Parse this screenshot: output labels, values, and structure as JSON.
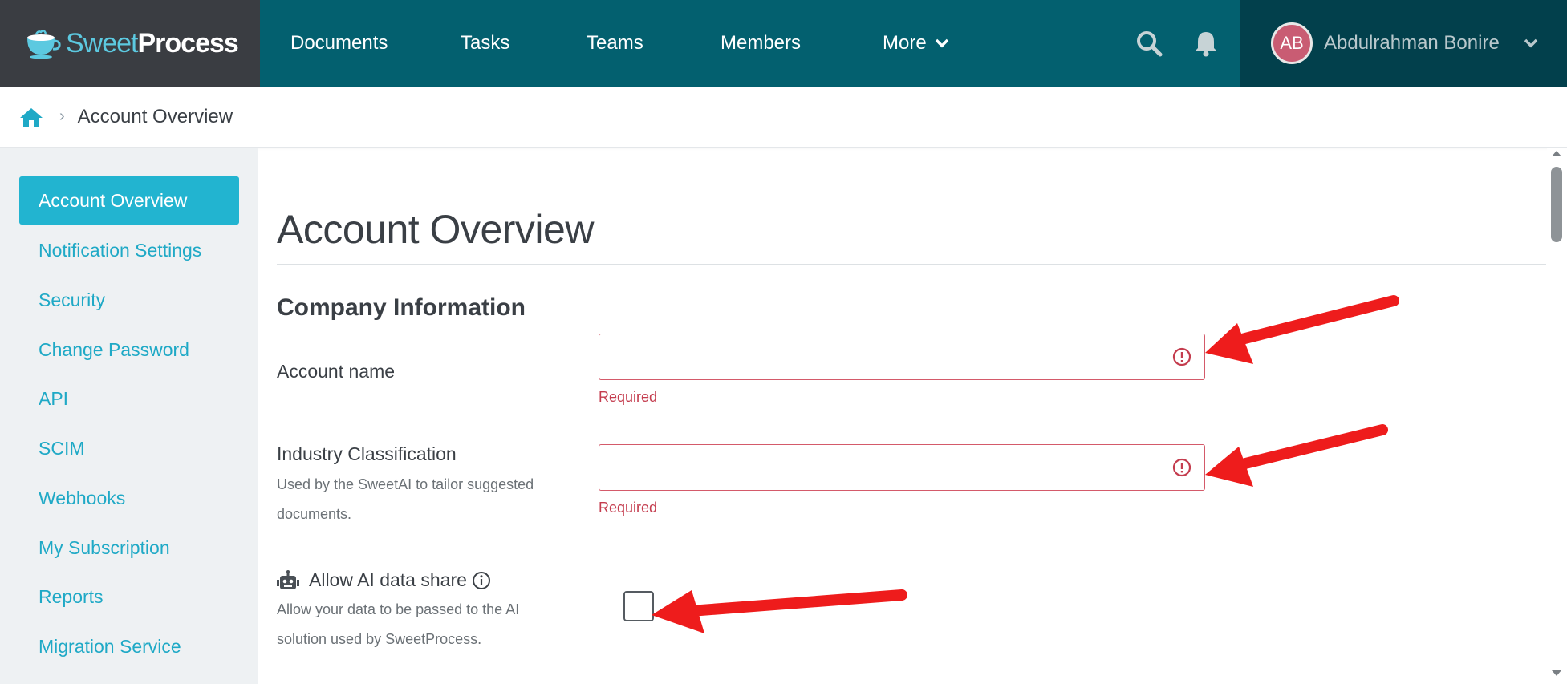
{
  "app": {
    "logo_prefix": "Sweet",
    "logo_suffix": "Process"
  },
  "nav": {
    "items": [
      {
        "label": "Documents"
      },
      {
        "label": "Tasks"
      },
      {
        "label": "Teams"
      },
      {
        "label": "Members"
      },
      {
        "label": "More"
      }
    ],
    "search_icon": "search-icon",
    "bell_icon": "bell-icon"
  },
  "user": {
    "initials": "AB",
    "name": "Abdulrahman Bonire"
  },
  "breadcrumb": {
    "current": "Account Overview"
  },
  "sidebar": {
    "items": [
      {
        "label": "Account Overview"
      },
      {
        "label": "Notification Settings"
      },
      {
        "label": "Security"
      },
      {
        "label": "Change Password"
      },
      {
        "label": "API"
      },
      {
        "label": "SCIM"
      },
      {
        "label": "Webhooks"
      },
      {
        "label": "My Subscription"
      },
      {
        "label": "Reports"
      },
      {
        "label": "Migration Service"
      }
    ]
  },
  "main": {
    "title": "Account Overview",
    "section_title": "Company Information",
    "account_name": {
      "label": "Account name",
      "value": "",
      "error": "Required"
    },
    "industry": {
      "label": "Industry Classification",
      "help": "Used by the SweetAI to tailor suggested documents.",
      "value": "",
      "error": "Required"
    },
    "ai_share": {
      "label": "Allow AI data share",
      "help": "Allow your data to be passed to the AI solution used by SweetProcess.",
      "checked": false
    }
  },
  "colors": {
    "nav_bg": "#03606f",
    "logo_bg": "#3a3d42",
    "user_bg": "#02404c",
    "accent": "#22b4d0",
    "error": "#c43c4e",
    "annotation_arrow": "#ee1c1c"
  }
}
